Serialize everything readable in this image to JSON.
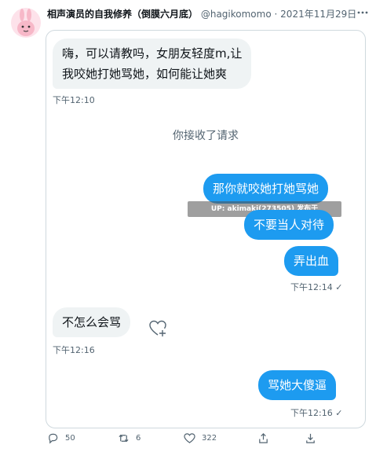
{
  "tweet": {
    "author_name": "相声演员的自我修养（倒膜六月底）",
    "author_handle": "@hagikomomo",
    "separator": "·",
    "date": "2021年11月29日"
  },
  "chat": {
    "msg1": "嗨，可以请教吗，女朋友轻度m,让",
    "msg1b": "我咬她打她骂她，如何能让她爽",
    "time1": "下午12:10",
    "system": "你接收了请求",
    "msg2": "那你就咬她打她骂她",
    "msg3": "不要当人对待",
    "msg4": "弄出血",
    "time2": "下午12:14",
    "msg5": "不怎么会骂",
    "time3": "下午12:16",
    "msg6": "骂她大傻逼",
    "time4": "下午12:16",
    "watermark": "UP: akimaki(273505) 发布于 mengzhan.cc"
  },
  "actions": {
    "reply_count": "50",
    "retweet_count": "6",
    "like_count": "322"
  },
  "colors": {
    "accent": "#1d9bf0",
    "bubble_left": "#eff3f4",
    "meta": "#536471"
  }
}
